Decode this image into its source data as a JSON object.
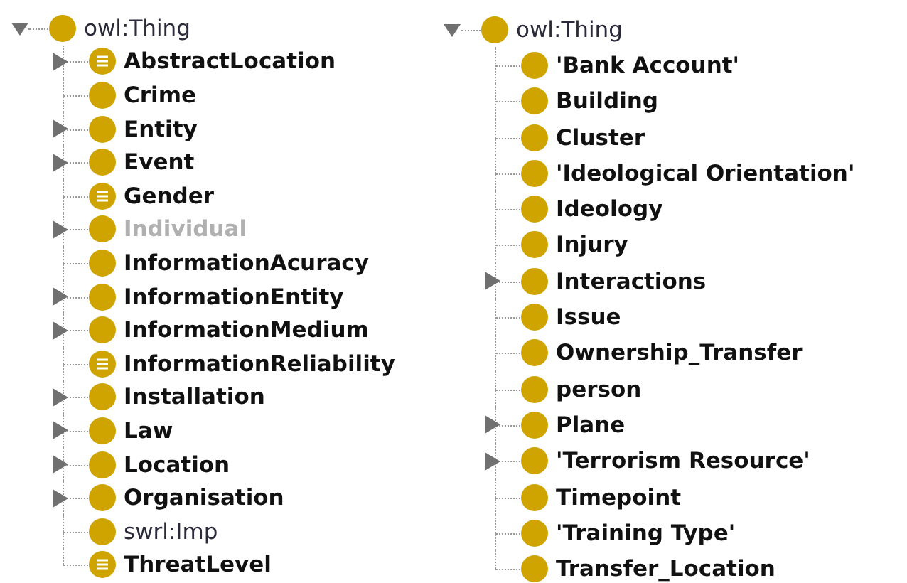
{
  "trees": [
    {
      "root": {
        "label": "owl:Thing",
        "kind": "builtin",
        "expanded": true
      },
      "items": [
        {
          "label": "AbstractLocation",
          "kind": "class",
          "expandable": true,
          "defined": true,
          "disabled": false
        },
        {
          "label": "Crime",
          "kind": "class",
          "expandable": false,
          "defined": false,
          "disabled": false
        },
        {
          "label": "Entity",
          "kind": "class",
          "expandable": true,
          "defined": false,
          "disabled": false
        },
        {
          "label": "Event",
          "kind": "class",
          "expandable": true,
          "defined": false,
          "disabled": false
        },
        {
          "label": "Gender",
          "kind": "class",
          "expandable": false,
          "defined": true,
          "disabled": false
        },
        {
          "label": "Individual",
          "kind": "class",
          "expandable": true,
          "defined": false,
          "disabled": true
        },
        {
          "label": "InformationAcuracy",
          "kind": "class",
          "expandable": false,
          "defined": false,
          "disabled": false
        },
        {
          "label": "InformationEntity",
          "kind": "class",
          "expandable": true,
          "defined": false,
          "disabled": false
        },
        {
          "label": "InformationMedium",
          "kind": "class",
          "expandable": true,
          "defined": false,
          "disabled": false
        },
        {
          "label": "InformationReliability",
          "kind": "class",
          "expandable": false,
          "defined": true,
          "disabled": false
        },
        {
          "label": "Installation",
          "kind": "class",
          "expandable": true,
          "defined": false,
          "disabled": false
        },
        {
          "label": "Law",
          "kind": "class",
          "expandable": true,
          "defined": false,
          "disabled": false
        },
        {
          "label": "Location",
          "kind": "class",
          "expandable": true,
          "defined": false,
          "disabled": false
        },
        {
          "label": "Organisation",
          "kind": "class",
          "expandable": true,
          "defined": false,
          "disabled": false
        },
        {
          "label": "swrl:Imp",
          "kind": "builtin",
          "expandable": false,
          "defined": false,
          "disabled": false
        },
        {
          "label": "ThreatLevel",
          "kind": "class",
          "expandable": false,
          "defined": true,
          "disabled": false
        }
      ]
    },
    {
      "root": {
        "label": "owl:Thing",
        "kind": "builtin",
        "expanded": true
      },
      "items": [
        {
          "label": "'Bank Account'",
          "kind": "class",
          "expandable": false,
          "defined": false,
          "disabled": false
        },
        {
          "label": "Building",
          "kind": "class",
          "expandable": false,
          "defined": false,
          "disabled": false
        },
        {
          "label": "Cluster",
          "kind": "class",
          "expandable": false,
          "defined": false,
          "disabled": false
        },
        {
          "label": "'Ideological Orientation'",
          "kind": "class",
          "expandable": false,
          "defined": false,
          "disabled": false
        },
        {
          "label": "Ideology",
          "kind": "class",
          "expandable": false,
          "defined": false,
          "disabled": false
        },
        {
          "label": "Injury",
          "kind": "class",
          "expandable": false,
          "defined": false,
          "disabled": false
        },
        {
          "label": "Interactions",
          "kind": "class",
          "expandable": true,
          "defined": false,
          "disabled": false
        },
        {
          "label": "Issue",
          "kind": "class",
          "expandable": false,
          "defined": false,
          "disabled": false
        },
        {
          "label": "Ownership_Transfer",
          "kind": "class",
          "expandable": false,
          "defined": false,
          "disabled": false
        },
        {
          "label": "person",
          "kind": "class",
          "expandable": false,
          "defined": false,
          "disabled": false
        },
        {
          "label": "Plane",
          "kind": "class",
          "expandable": true,
          "defined": false,
          "disabled": false
        },
        {
          "label": "'Terrorism Resource'",
          "kind": "class",
          "expandable": true,
          "defined": false,
          "disabled": false
        },
        {
          "label": "Timepoint",
          "kind": "class",
          "expandable": false,
          "defined": false,
          "disabled": false
        },
        {
          "label": "'Training Type'",
          "kind": "class",
          "expandable": false,
          "defined": false,
          "disabled": false
        },
        {
          "label": "Transfer_Location",
          "kind": "class",
          "expandable": false,
          "defined": false,
          "disabled": false
        }
      ]
    }
  ]
}
